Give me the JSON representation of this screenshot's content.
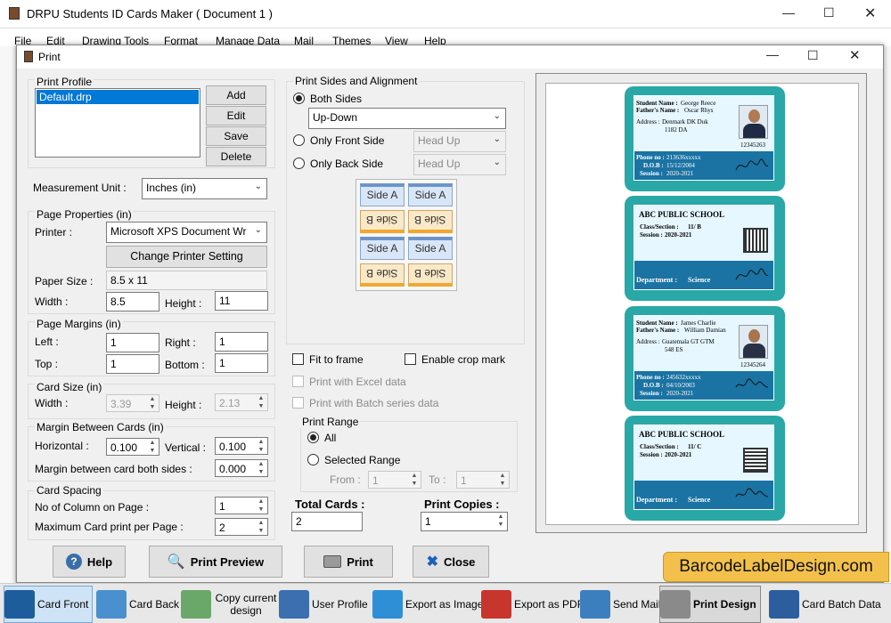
{
  "app": {
    "title": "DRPU Students ID Cards Maker ( Document 1 )",
    "menu": [
      "File",
      "Edit",
      "Drawing Tools",
      "Format",
      "Manage Data",
      "Mail",
      "Themes",
      "View",
      "Help"
    ]
  },
  "dialog": {
    "title": "Print",
    "print_profile": {
      "label": "Print Profile",
      "items": [
        "Default.drp"
      ],
      "add": "Add",
      "edit": "Edit",
      "save": "Save",
      "delete": "Delete"
    },
    "measurement_unit": {
      "label": "Measurement Unit :",
      "value": "Inches (in)"
    },
    "page_properties": {
      "label": "Page Properties (in)",
      "printer_label": "Printer :",
      "printer_value": "Microsoft XPS Document Wr",
      "change_printer": "Change Printer Setting",
      "paper_size_label": "Paper Size :",
      "paper_size_value": "8.5 x 11",
      "width_label": "Width :",
      "width_value": "8.5",
      "height_label": "Height :",
      "height_value": "11"
    },
    "page_margins": {
      "label": "Page Margins (in)",
      "left_label": "Left :",
      "left_value": "1",
      "right_label": "Right :",
      "right_value": "1",
      "top_label": "Top :",
      "top_value": "1",
      "bottom_label": "Bottom :",
      "bottom_value": "1"
    },
    "card_size": {
      "label": "Card Size (in)",
      "width_label": "Width :",
      "width_value": "3.39",
      "height_label": "Height :",
      "height_value": "2.13"
    },
    "margin_between_cards": {
      "label": "Margin Between Cards (in)",
      "horizontal_label": "Horizontal :",
      "horizontal_value": "0.100",
      "vertical_label": "Vertical :",
      "vertical_value": "0.100",
      "both_label": "Margin between card both sides :",
      "both_value": "0.000"
    },
    "card_spacing": {
      "label": "Card Spacing",
      "columns_label": "No of Column on Page :",
      "columns_value": "1",
      "max_label": "Maximum Card print per Page :",
      "max_value": "2"
    },
    "sides": {
      "label": "Print Sides and Alignment",
      "both_sides": "Both Sides",
      "both_sides_value": "Up-Down",
      "only_front": "Only Front Side",
      "only_front_value": "Head Up",
      "only_back": "Only Back Side",
      "only_back_value": "Head Up",
      "side_a": "Side A",
      "side_b": "Side B"
    },
    "options": {
      "fit_to_frame": "Fit to frame",
      "enable_crop": "Enable crop mark",
      "print_excel": "Print with Excel data",
      "print_batch": "Print with Batch series data"
    },
    "print_range": {
      "label": "Print Range",
      "all": "All",
      "selected": "Selected Range",
      "from_label": "From :",
      "from_value": "1",
      "to_label": "To :",
      "to_value": "1"
    },
    "total_cards": {
      "label": "Total Cards :",
      "value": "2"
    },
    "print_copies": {
      "label": "Print Copies :",
      "value": "1"
    },
    "buttons": {
      "help": "Help",
      "preview": "Print Preview",
      "print": "Print",
      "close": "Close"
    }
  },
  "preview_cards": [
    {
      "kind": "front",
      "student_name_label": "Student Name :",
      "student_name": "George Reece",
      "father_label": "Father's Name :",
      "father": "Oscar Rhys",
      "address_label": "Address :",
      "address1": "Denmark DK Duk",
      "address2": "1182 DA",
      "id": "12345263",
      "phone_label": "Phone no :",
      "phone": "213636xxxxx",
      "dob_label": "D.O.B :",
      "dob": "15/12/2004",
      "session_label": "Session :",
      "session": "2020-2021"
    },
    {
      "kind": "back",
      "school": "ABC PUBLIC SCHOOL",
      "class_label": "Class/Section :",
      "class": "11/ B",
      "session_label": "Session :",
      "session": "2020-2021",
      "department_label": "Department :",
      "department": "Science"
    },
    {
      "kind": "front",
      "student_name_label": "Student Name :",
      "student_name": "James Charlie",
      "father_label": "Father's Name :",
      "father": "William Damian",
      "address_label": "Address :",
      "address1": "Guatemala GT GTM",
      "address2": "548 ES",
      "id": "12345264",
      "phone_label": "Phone no :",
      "phone": "245632xxxxx",
      "dob_label": "D.O.B :",
      "dob": "04/10/2003",
      "session_label": "Session :",
      "session": "2020-2021"
    },
    {
      "kind": "back",
      "school": "ABC PUBLIC SCHOOL",
      "class_label": "Class/Section :",
      "class": "11/ C",
      "session_label": "Session :",
      "session": "2020-2021",
      "department_label": "Department :",
      "department": "Science"
    }
  ],
  "watermark": "BarcodeLabelDesign.com",
  "taskbar": [
    {
      "label": "Card Front",
      "icon": "card-front-icon"
    },
    {
      "label": "Card Back",
      "icon": "card-back-icon"
    },
    {
      "label": "Copy current design",
      "icon": "copy-design-icon"
    },
    {
      "label": "User Profile",
      "icon": "user-profile-icon"
    },
    {
      "label": "Export as Image",
      "icon": "export-image-icon"
    },
    {
      "label": "Export as PDF",
      "icon": "export-pdf-icon"
    },
    {
      "label": "Send Mail",
      "icon": "send-mail-icon"
    },
    {
      "label": "Print Design",
      "icon": "print-design-icon"
    },
    {
      "label": "Card Batch Data",
      "icon": "card-batch-icon"
    }
  ]
}
